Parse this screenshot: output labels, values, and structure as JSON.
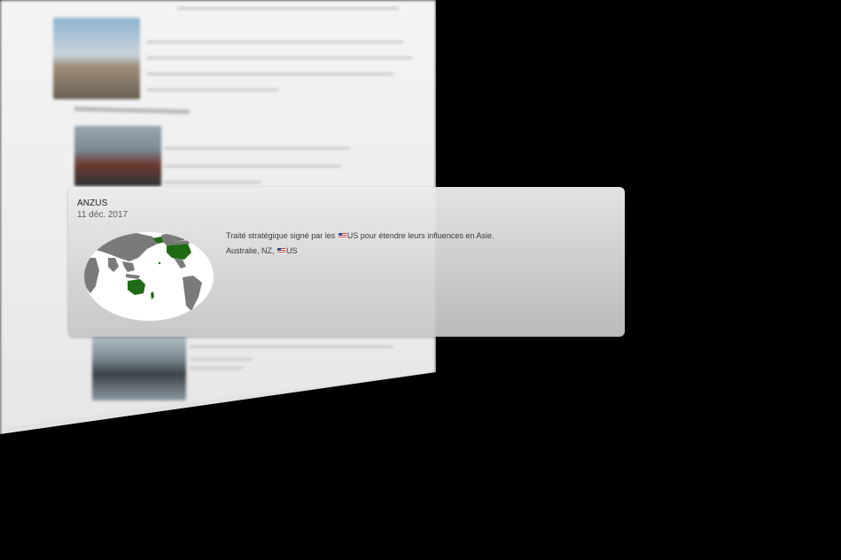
{
  "event": {
    "title": "ANZUS",
    "date": "11 déc. 2017",
    "description_before_flag": "Traité stratégique signé par les ",
    "description_flag_code": "US",
    "description_after_flag": " pour étendre leurs influences en Asie.",
    "members_text": "Australie, NZ, ",
    "members_flag_code": "US",
    "flag_icon": "us-flag-icon",
    "map_icon": "world-map-icon"
  },
  "colors": {
    "highlight_country": "#1f6b14",
    "map_land": "#7a7a7a",
    "map_ocean": "#ffffff",
    "card_bg": "#d8d8d8"
  }
}
